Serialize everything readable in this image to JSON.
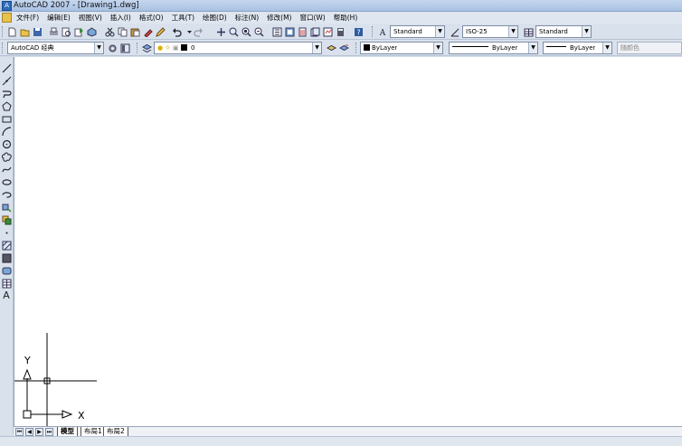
{
  "window": {
    "title": "AutoCAD 2007 - [Drawing1.dwg]"
  },
  "menu": [
    "文件(F)",
    "编辑(E)",
    "视图(V)",
    "插入(I)",
    "格式(O)",
    "工具(T)",
    "绘图(D)",
    "标注(N)",
    "修改(M)",
    "窗口(W)",
    "帮助(H)"
  ],
  "toolbar": {
    "text_style": "Standard",
    "dim_style": "ISO-25",
    "table_style": "Standard",
    "workspace": "AutoCAD 经典",
    "layer": "0",
    "color": "ByLayer",
    "linetype": "ByLayer",
    "lineweight": "ByLayer",
    "plot_style": "随颜色"
  },
  "draw_toolbar": {
    "mtext_glyph": "A"
  },
  "ucs": {
    "x_label": "X",
    "y_label": "Y"
  },
  "tabs": [
    "模型",
    "布局1",
    "布局2"
  ],
  "colors": {
    "accent": "#2d6bb8",
    "chrome": "#d9e1ec",
    "canvas": "#ffffff"
  }
}
